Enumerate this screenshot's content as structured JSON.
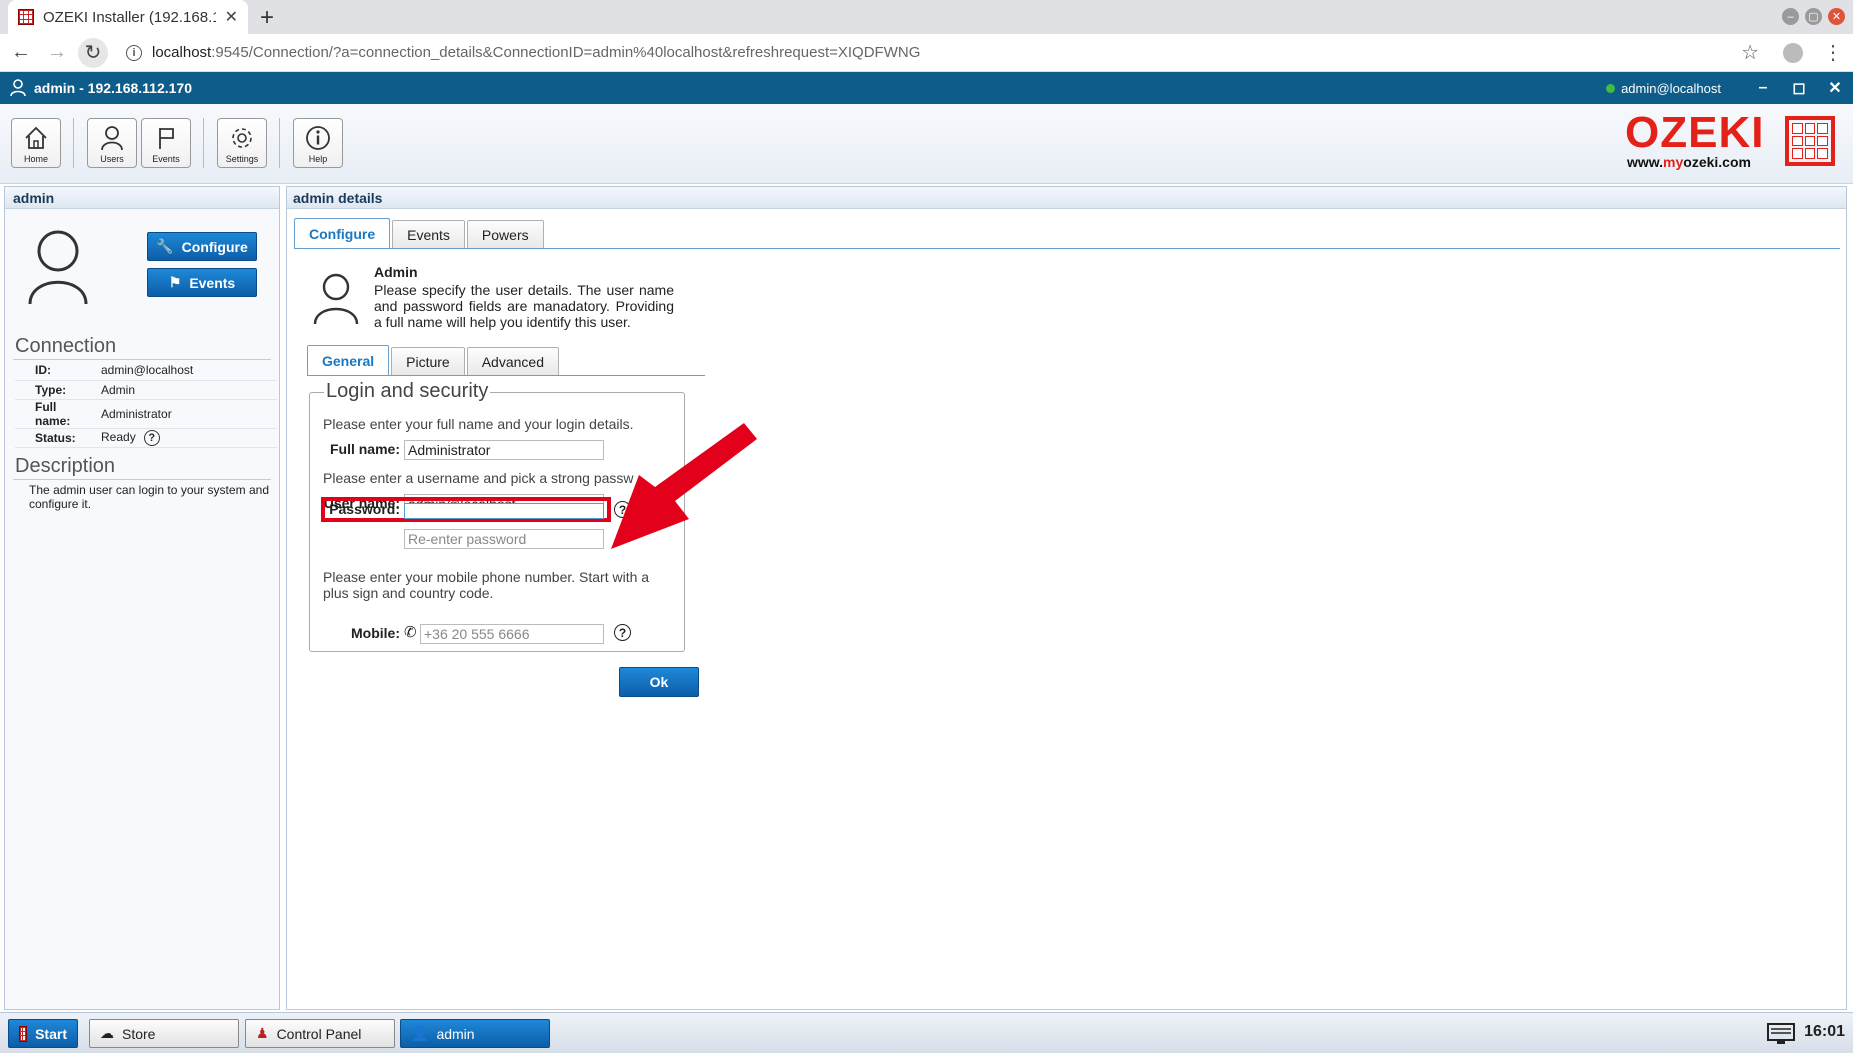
{
  "browser": {
    "tab_title": "OZEKI Installer (192.168.1",
    "url_host": "localhost",
    "url_rest": ":9545/Connection/?a=connection_details&ConnectionID=admin%40localhost&refreshrequest=XIQDFWNG"
  },
  "app": {
    "title": "admin - 192.168.112.170",
    "logged_user": "admin@localhost"
  },
  "toolbar": {
    "home": "Home",
    "users": "Users",
    "events": "Events",
    "settings": "Settings",
    "help": "Help"
  },
  "logo": {
    "brand": "OZEKI",
    "url_prefix": "www.",
    "url_my": "my",
    "url_suffix": "ozeki.com"
  },
  "left": {
    "header": "admin",
    "configure_btn": "Configure",
    "events_btn": "Events",
    "connection_title": "Connection",
    "props": [
      {
        "key": "ID:",
        "value": "admin@localhost"
      },
      {
        "key": "Type:",
        "value": "Admin"
      },
      {
        "key": "Full name:",
        "value": "Administrator"
      },
      {
        "key": "Status:",
        "value": "Ready"
      }
    ],
    "description_title": "Description",
    "description": "The admin user can login to your system and configure it."
  },
  "main": {
    "header": "admin details",
    "tabs": [
      "Configure",
      "Events",
      "Powers"
    ],
    "info_title": "Admin",
    "info_text": "Please specify the user details. The user name and password fields are manadatory. Providing a full name will help you identify this user.",
    "subtabs": [
      "General",
      "Picture",
      "Advanced"
    ],
    "fieldset_legend": "Login and security",
    "hint_fullname": "Please enter your full name and your login details.",
    "label_fullname": "Full name:",
    "value_fullname": "Administrator",
    "hint_username": "Please enter a username and pick a strong passw",
    "label_username": "User name:",
    "value_username": "admin@localhost",
    "label_password": "Password:",
    "value_password": "",
    "placeholder_reenter": "Re-enter password",
    "hint_mobile": "Please enter your mobile phone number. Start with a plus sign and country code.",
    "label_mobile": "Mobile:",
    "placeholder_mobile": "+36 20 555 6666",
    "ok_btn": "Ok"
  },
  "taskbar": {
    "start": "Start",
    "store": "Store",
    "control_panel": "Control Panel",
    "admin": "admin",
    "clock": "16:01"
  },
  "colors": {
    "titlebar": "#0e5c8a",
    "accent": "#1a78c2",
    "highlight_red": "#e3001b",
    "brand_red": "#e32119"
  }
}
